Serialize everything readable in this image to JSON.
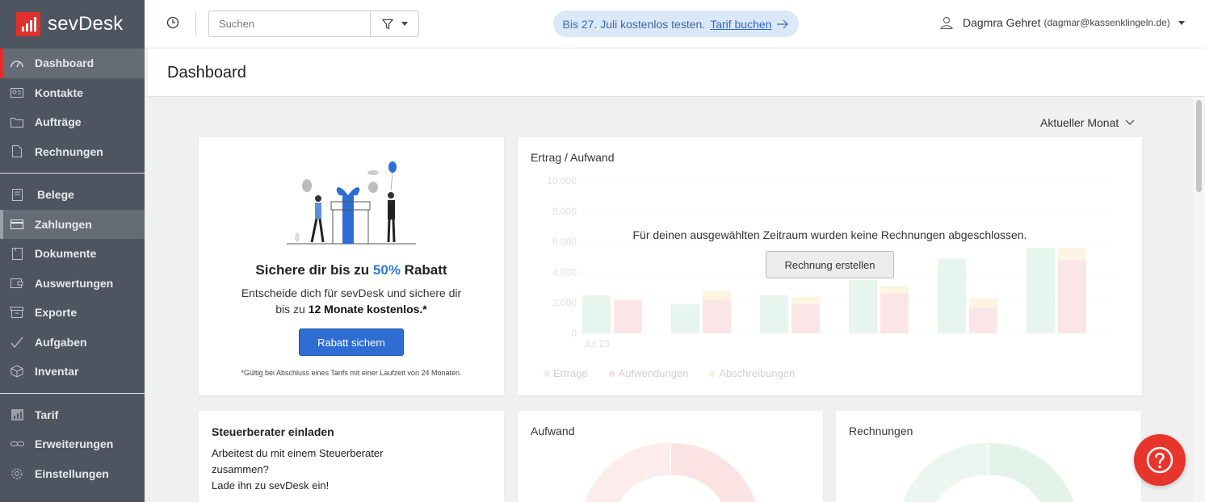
{
  "app": {
    "logo_text": "sevDesk",
    "brand_color": "#e0302b"
  },
  "sidebar": {
    "items": [
      {
        "label": "Dashboard",
        "icon": "dashboard-icon"
      },
      {
        "label": "Kontakte",
        "icon": "contacts-icon"
      },
      {
        "label": "Aufträge",
        "icon": "folder-icon"
      },
      {
        "label": "Rechnungen",
        "icon": "document-icon"
      },
      {
        "label": "Belege",
        "icon": "receipt-icon"
      },
      {
        "label": "Zahlungen",
        "icon": "credit-card-icon"
      },
      {
        "label": "Dokumente",
        "icon": "file-icon"
      },
      {
        "label": "Auswertungen",
        "icon": "report-icon"
      },
      {
        "label": "Exporte",
        "icon": "export-icon"
      },
      {
        "label": "Aufgaben",
        "icon": "check-icon"
      },
      {
        "label": "Inventar",
        "icon": "box-icon"
      },
      {
        "label": "Tarif",
        "icon": "bar-chart-icon"
      },
      {
        "label": "Erweiterungen",
        "icon": "link-icon"
      },
      {
        "label": "Einstellungen",
        "icon": "gear-icon"
      }
    ]
  },
  "topbar": {
    "search_placeholder": "Suchen",
    "trial_text": "Bis 27. Juli kostenlos testen.",
    "trial_link": "Tarif buchen",
    "user_name": "Dagmra Gehret",
    "user_email": "(dagmar@kassenklingeln.de)"
  },
  "page": {
    "title": "Dashboard",
    "period": "Aktueller Monat"
  },
  "promo": {
    "title_prefix": "Sichere dir bis zu ",
    "title_highlight": "50%",
    "title_suffix": " Rabatt",
    "desc_line1": "Entscheide dich für sevDesk und sichere dir",
    "desc_line2_prefix": "bis zu ",
    "desc_line2_bold": "12 Monate kostenlos.*",
    "button": "Rabatt sichern",
    "footnote": "*Gültig bei Abschluss eines Tarifs mit einer Laufzeit von 24 Monaten."
  },
  "income_chart": {
    "title": "Ertrag / Aufwand",
    "empty_message": "Für deinen ausgewählten Zeitraum wurden keine Rechnungen abgeschlossen.",
    "button": "Rechnung erstellen"
  },
  "chart_data": {
    "type": "bar",
    "title": "Ertrag / Aufwand",
    "y_ticks": [
      "10.000",
      "8.000",
      "6.000",
      "4.000",
      "2.000",
      "0"
    ],
    "ylim": [
      0,
      10000
    ],
    "categories": [
      "Jul 23",
      "",
      "",
      "",
      "",
      ""
    ],
    "series": [
      {
        "name": "Erträge",
        "color": "#c9ebd9",
        "values": [
          2500,
          1900,
          2500,
          3500,
          4900,
          5600
        ]
      },
      {
        "name": "Aufwendungen",
        "color": "#f7c9cc",
        "values": [
          2200,
          2200,
          1900,
          2600,
          1700,
          4800
        ]
      },
      {
        "name": "Abschreibungen",
        "color": "#fbe7bd",
        "values": [
          0,
          600,
          500,
          500,
          600,
          800
        ]
      }
    ]
  },
  "tax": {
    "title": "Steuerberater einladen",
    "line1": "Arbeitest du mit einem Steuerberater",
    "line2": "zusammen?",
    "line3": "Lade ihn zu sevDesk ein!"
  },
  "aufwand": {
    "title": "Aufwand"
  },
  "rechnungen": {
    "title": "Rechnungen"
  }
}
